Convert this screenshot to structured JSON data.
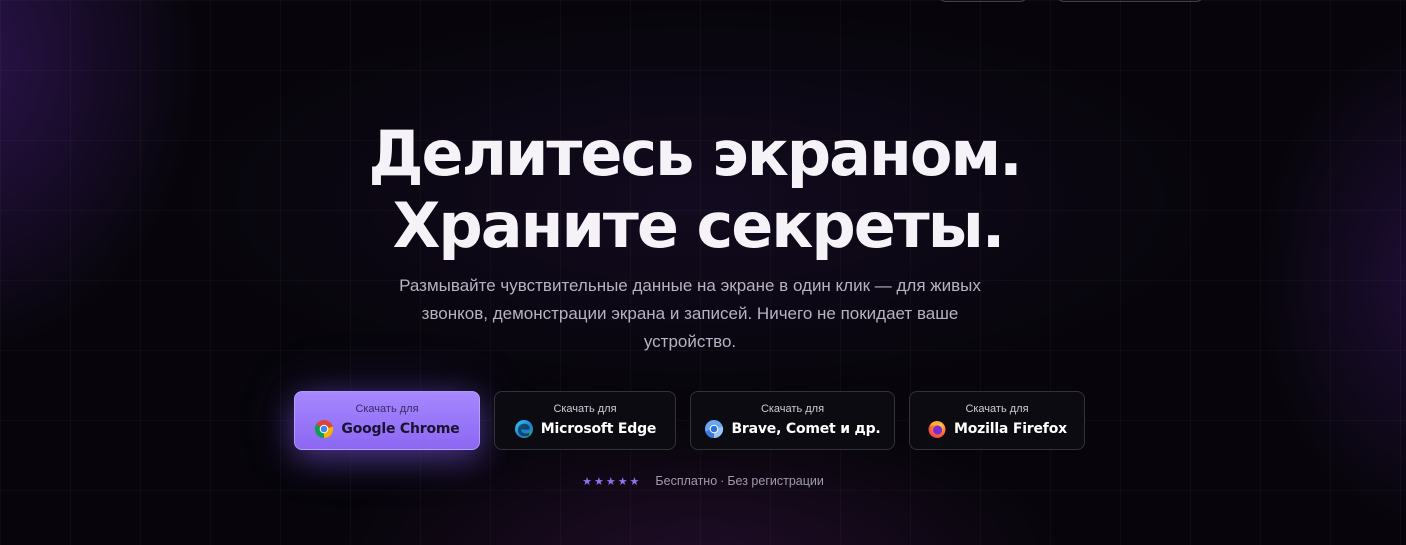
{
  "hero": {
    "headline_line1": "Делитесь экраном.",
    "headline_line2": "Храните секреты.",
    "subtitle": "Размывайте чувствительные данные на экране в один клик — для живых звонков, демонстрации экрана и записей. Ничего не покидает ваше устройство."
  },
  "downloads": [
    {
      "caption": "Скачать для",
      "name": "Google Chrome",
      "icon": "chrome-icon"
    },
    {
      "caption": "Скачать для",
      "name": "Microsoft Edge",
      "icon": "edge-icon"
    },
    {
      "caption": "Скачать для",
      "name": "Brave, Comet и др.",
      "icon": "chromium-icon"
    },
    {
      "caption": "Скачать для",
      "name": "Mozilla Firefox",
      "icon": "firefox-icon"
    }
  ],
  "footnote": {
    "stars": "★★★★★",
    "free": "Бесплатно",
    "separator": "·",
    "no_signup": "Без регистрации"
  },
  "colors": {
    "accent": "#8c67f2",
    "background": "#07050b"
  }
}
